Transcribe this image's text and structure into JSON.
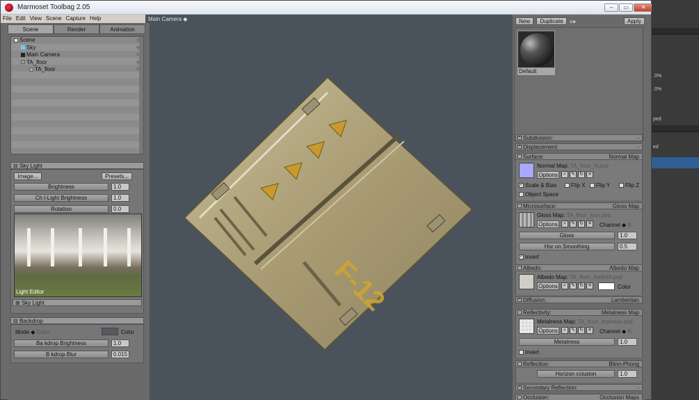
{
  "window": {
    "title": "Marmoset Toolbag 2.05",
    "minimize": "–",
    "maximize": "▭",
    "close": "✕"
  },
  "menu": [
    "File",
    "Edit",
    "View",
    "Scene",
    "Capture",
    "Help"
  ],
  "left_tabs": [
    "Scene",
    "Render",
    "Animation"
  ],
  "outliner": [
    {
      "label": "Scene",
      "indent": 0
    },
    {
      "label": "Sky",
      "indent": 1
    },
    {
      "label": "Main Camera",
      "indent": 1
    },
    {
      "label": "TA_floor",
      "indent": 1
    },
    {
      "label": "TA_floor",
      "indent": 2
    }
  ],
  "sky_light": {
    "header": "Sky Light",
    "image_button": "Image...",
    "presets_button": "Presets...",
    "rows": [
      {
        "label": "Brightness",
        "value": "1.0"
      },
      {
        "label": "Ch  l-Light Brightness",
        "value": "1.0"
      },
      {
        "label": "Rotation",
        "value": "0.0"
      }
    ],
    "preview_label": "Light Editor",
    "sub_header": "Sky Light"
  },
  "backdrop": {
    "header": "Backdrop",
    "mode_label": "Mode",
    "mode_value": "Color",
    "color_label": "Color",
    "color_swatch": "#555a60",
    "rows": [
      {
        "label": "Ba  kdrop Brightness",
        "value": "1.0"
      },
      {
        "label": "B  kdrop Blur",
        "value": "0.015"
      }
    ]
  },
  "viewport": {
    "camera_label": "Main Camera ◆",
    "stencil_text": "F-12",
    "background": "#4a535b"
  },
  "material": {
    "new_button": "New",
    "duplicate_button": "Duplicate",
    "menu_icon": "≡▾",
    "apply_button": "Apply",
    "name": "Default"
  },
  "inspector": {
    "subdivision": {
      "label": "Subdivision:",
      "value": "-"
    },
    "displacement": {
      "label": "Displacement:",
      "value": "-"
    },
    "surface": {
      "label": "Surface:",
      "value": "Normal Map",
      "map_label": "Normal Map:",
      "map_file": "TA_floor_N.psd",
      "options": "Options",
      "scale_bias": "Scale & Bias",
      "flip_x": "Flip X",
      "flip_y": "Flip Y",
      "flip_z": "Flip Z",
      "object_space": "Object Space"
    },
    "microsurface": {
      "label": "Microsurface:",
      "value": "Gloss Map",
      "map_label": "Gloss Map:",
      "map_file": "TA_floor_loss.psd",
      "options": "Options",
      "channel": "Channel",
      "channel_value": "R",
      "gloss_label": "Gloss",
      "gloss_value": "1.0",
      "horizon_label": "Hor  on Smoothing",
      "horizon_value": "0.5",
      "invert": "Invert"
    },
    "albedo": {
      "label": "Albedo:",
      "value": "Albedo Map",
      "map_label": "Albedo Map:",
      "map_file": "TA_floor_lbedoM.psd",
      "options": "Options",
      "color_label": "Color"
    },
    "diffusion": {
      "label": "Diffusion:",
      "value": "Lambertian"
    },
    "reflectivity": {
      "label": "Reflectivity:",
      "value": "Metalness Map",
      "map_label": "Metalness Map:",
      "map_file": "TA_floor_etalness.psd",
      "options": "Options",
      "channel": "Channel",
      "channel_value": "R",
      "metal_label": "Metalness",
      "metal_value": "1.0",
      "invert": "Invert"
    },
    "reflection": {
      "label": "Reflection:",
      "value": "Blinn-Phong",
      "horizon_label": "Horizon  cclusion",
      "horizon_value": "1.0"
    },
    "secondary": {
      "label": "Secondary Reflection:",
      "value": "-"
    },
    "occlusion": {
      "label": "Occlusion:",
      "value": "Occlusion Maps"
    }
  },
  "bg_app": {
    "pct1": ".0%",
    "pct2": ".0%",
    "word1": "ped",
    "word2": "ed"
  }
}
